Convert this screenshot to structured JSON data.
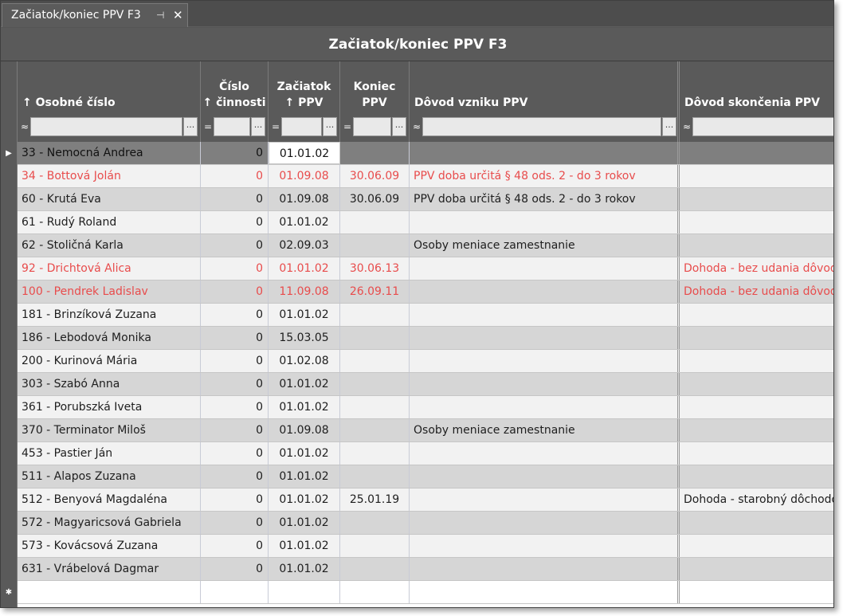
{
  "tab": {
    "label": "Začiatok/koniec PPV F3",
    "pin_glyph": "⊣",
    "close_glyph": "✕"
  },
  "view": {
    "title": "Začiatok/koniec PPV F3"
  },
  "columns": [
    {
      "label": "↑ Osobné číslo",
      "filter_op": "≈",
      "has_button": true
    },
    {
      "label": "Číslo\n↑ činnosti",
      "filter_op": "=",
      "has_button": true
    },
    {
      "label": "Začiatok\n↑ PPV",
      "filter_op": "=",
      "has_button": true
    },
    {
      "label": "Koniec\nPPV",
      "filter_op": "=",
      "has_button": true
    },
    {
      "label": "Dôvod vzniku PPV",
      "filter_op": "≈",
      "has_button": true
    },
    {
      "label": "Dôvod skončenia PPV",
      "filter_op": "≈",
      "has_button": false
    }
  ],
  "filter_button_label": "...",
  "indicators": {
    "current": "▶",
    "new": "✱"
  },
  "rows": [
    {
      "osobne": "33 - Nemocná Andrea",
      "cinnost": "0",
      "zaciatok": "01.01.02",
      "koniec": "",
      "vznik": "",
      "skoncenie": "",
      "red": false,
      "selected": true
    },
    {
      "osobne": "34 - Bottová Jolán",
      "cinnost": "0",
      "zaciatok": "01.09.08",
      "koniec": "30.06.09",
      "vznik": "PPV doba určitá § 48 ods. 2 - do 3 rokov",
      "skoncenie": "",
      "red": true
    },
    {
      "osobne": "60 - Krutá Eva",
      "cinnost": "0",
      "zaciatok": "01.09.08",
      "koniec": "30.06.09",
      "vznik": "PPV doba určitá § 48 ods. 2 - do 3 rokov",
      "skoncenie": "",
      "red": false
    },
    {
      "osobne": "61 - Rudý Roland",
      "cinnost": "0",
      "zaciatok": "01.01.02",
      "koniec": "",
      "vznik": "",
      "skoncenie": "",
      "red": false
    },
    {
      "osobne": "62 - Stoličná Karla",
      "cinnost": "0",
      "zaciatok": "02.09.03",
      "koniec": "",
      "vznik": "Osoby meniace zamestnanie",
      "skoncenie": "",
      "red": false
    },
    {
      "osobne": "92 - Drichtová Alica",
      "cinnost": "0",
      "zaciatok": "01.01.02",
      "koniec": "30.06.13",
      "vznik": "",
      "skoncenie": "Dohoda - bez udania dôvod",
      "red": true
    },
    {
      "osobne": "100 - Pendrek Ladislav",
      "cinnost": "0",
      "zaciatok": "11.09.08",
      "koniec": "26.09.11",
      "vznik": "",
      "skoncenie": "Dohoda - bez udania dôvod",
      "red": true
    },
    {
      "osobne": "181 - Brinzíková Zuzana",
      "cinnost": "0",
      "zaciatok": "01.01.02",
      "koniec": "",
      "vznik": "",
      "skoncenie": "",
      "red": false
    },
    {
      "osobne": "186 - Lebodová Monika",
      "cinnost": "0",
      "zaciatok": "15.03.05",
      "koniec": "",
      "vznik": "",
      "skoncenie": "",
      "red": false
    },
    {
      "osobne": "200 - Kurinová Mária",
      "cinnost": "0",
      "zaciatok": "01.02.08",
      "koniec": "",
      "vznik": "",
      "skoncenie": "",
      "red": false
    },
    {
      "osobne": "303 - Szabó Anna",
      "cinnost": "0",
      "zaciatok": "01.01.02",
      "koniec": "",
      "vznik": "",
      "skoncenie": "",
      "red": false
    },
    {
      "osobne": "361 - Porubszká Iveta",
      "cinnost": "0",
      "zaciatok": "01.01.02",
      "koniec": "",
      "vznik": "",
      "skoncenie": "",
      "red": false
    },
    {
      "osobne": "370 - Terminator Miloš",
      "cinnost": "0",
      "zaciatok": "01.09.08",
      "koniec": "",
      "vznik": "Osoby meniace zamestnanie",
      "skoncenie": "",
      "red": false
    },
    {
      "osobne": "453 - Pastier Ján",
      "cinnost": "0",
      "zaciatok": "01.01.02",
      "koniec": "",
      "vznik": "",
      "skoncenie": "",
      "red": false
    },
    {
      "osobne": "511 - Alapos Zuzana",
      "cinnost": "0",
      "zaciatok": "01.01.02",
      "koniec": "",
      "vznik": "",
      "skoncenie": "",
      "red": false
    },
    {
      "osobne": "512 - Benyová Magdaléna",
      "cinnost": "0",
      "zaciatok": "01.01.02",
      "koniec": "25.01.19",
      "vznik": "",
      "skoncenie": "Dohoda - starobný dôchodo",
      "red": false
    },
    {
      "osobne": "572 - Magyaricsová Gabriela",
      "cinnost": "0",
      "zaciatok": "01.01.02",
      "koniec": "",
      "vznik": "",
      "skoncenie": "",
      "red": false
    },
    {
      "osobne": "573 - Kovácsová Zuzana",
      "cinnost": "0",
      "zaciatok": "01.01.02",
      "koniec": "",
      "vznik": "",
      "skoncenie": "",
      "red": false
    },
    {
      "osobne": "631 - Vrábelová Dagmar",
      "cinnost": "0",
      "zaciatok": "01.01.02",
      "koniec": "",
      "vznik": "",
      "skoncenie": "",
      "red": false
    }
  ],
  "colors": {
    "text_red": "#e84c4c",
    "header_bg": "#5a5a5a",
    "row_selected": "#7f7f7f"
  }
}
